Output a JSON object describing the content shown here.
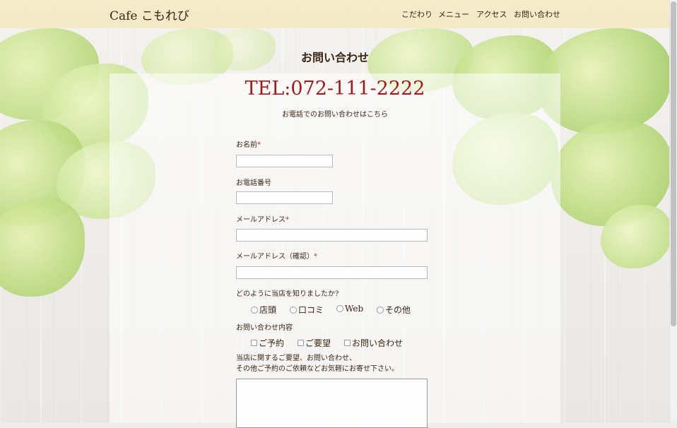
{
  "header": {
    "logo": "Cafe こもれび",
    "nav": [
      "こだわり",
      "メニュー",
      "アクセス",
      "お問い合わせ"
    ]
  },
  "page": {
    "title": "お問い合わせ",
    "tel": "TEL:072-111-2222",
    "tel_sub": "お電話でのお問い合わせはこちら"
  },
  "form": {
    "required_mark": "*",
    "name_label": "お名前",
    "phone_label": "お電話番号",
    "email_label": "メールアドレス",
    "email_confirm_label": "メールアドレス（確認）",
    "source_question": "どのように当店を知りましたか?",
    "source_options": [
      "店頭",
      "口コミ",
      "Web",
      "その他"
    ],
    "inquiry_label": "お問い合わせ内容",
    "inquiry_options": [
      "ご予約",
      "ご要望",
      "お問い合わせ"
    ],
    "note_line1": "当店に関するご要望、お問い合わせ、",
    "note_line2": "その他ご予約のご依頼などお気軽にお寄せ下さい。"
  },
  "colors": {
    "accent": "#9b1c1c",
    "header_bg": "#f5e8be",
    "required": "#c0392b"
  }
}
